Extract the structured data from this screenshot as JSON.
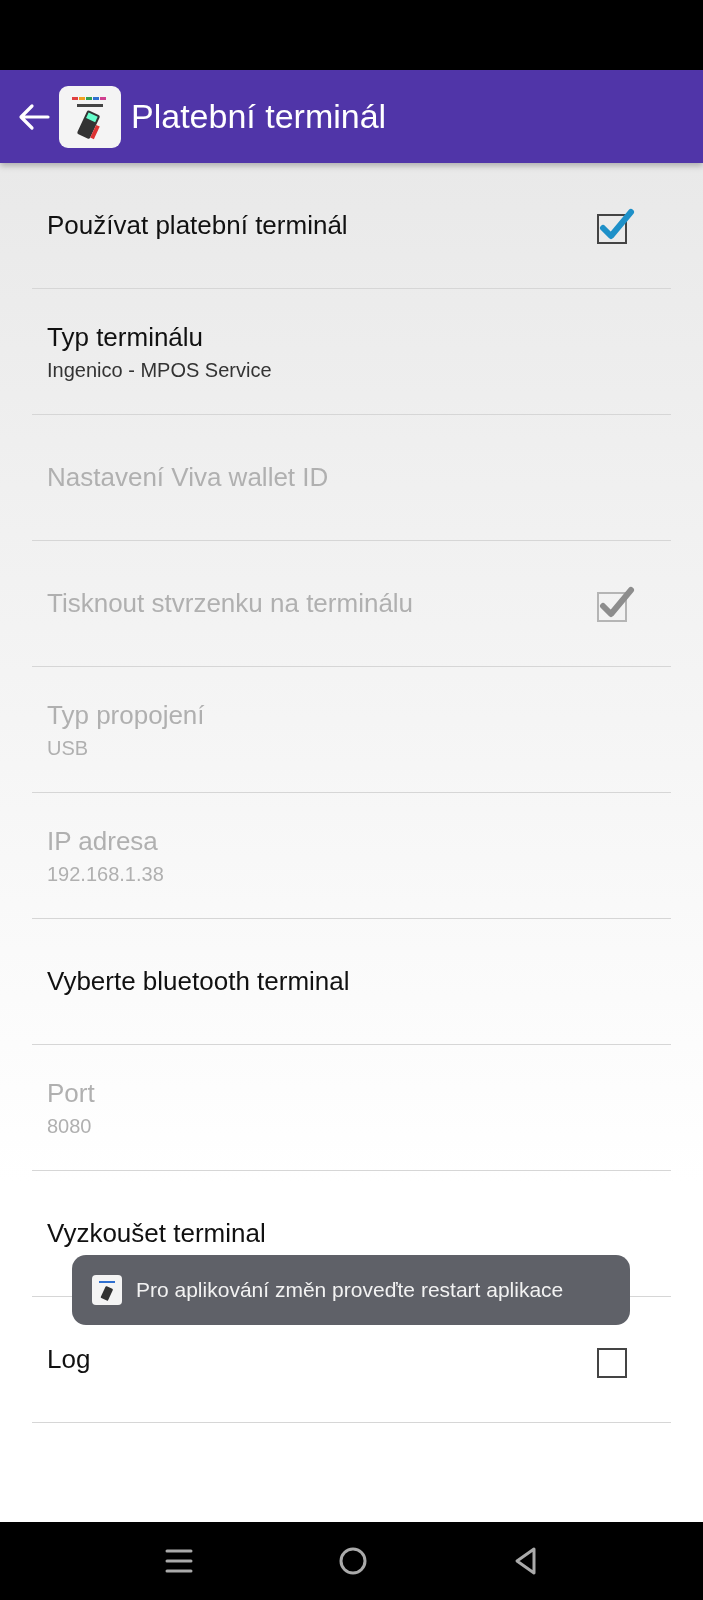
{
  "app_bar": {
    "title": "Platební terminál"
  },
  "settings": [
    {
      "kind": "checkbox",
      "title": "Používat platební terminál",
      "disabled": false,
      "checked": true
    },
    {
      "kind": "value",
      "title": "Typ terminálu",
      "value": "Ingenico - MPOS Service",
      "disabled": false
    },
    {
      "kind": "plain",
      "title": "Nastavení Viva wallet ID",
      "disabled": true
    },
    {
      "kind": "checkbox",
      "title": "Tisknout stvrzenku na terminálu",
      "disabled": true,
      "checked": true
    },
    {
      "kind": "value",
      "title": "Typ propojení",
      "value": "USB",
      "disabled": true
    },
    {
      "kind": "value",
      "title": "IP adresa",
      "value": "192.168.1.38",
      "disabled": true
    },
    {
      "kind": "plain",
      "title": "Vyberte bluetooth terminal",
      "disabled": false
    },
    {
      "kind": "value",
      "title": "Port",
      "value": "8080",
      "disabled": true
    },
    {
      "kind": "plain",
      "title": "Vyzkoušet terminal",
      "disabled": false
    },
    {
      "kind": "checkbox",
      "title": "Log",
      "disabled": false,
      "checked": false
    }
  ],
  "toast": {
    "message": "Pro aplikování změn proveďte restart aplikace"
  }
}
